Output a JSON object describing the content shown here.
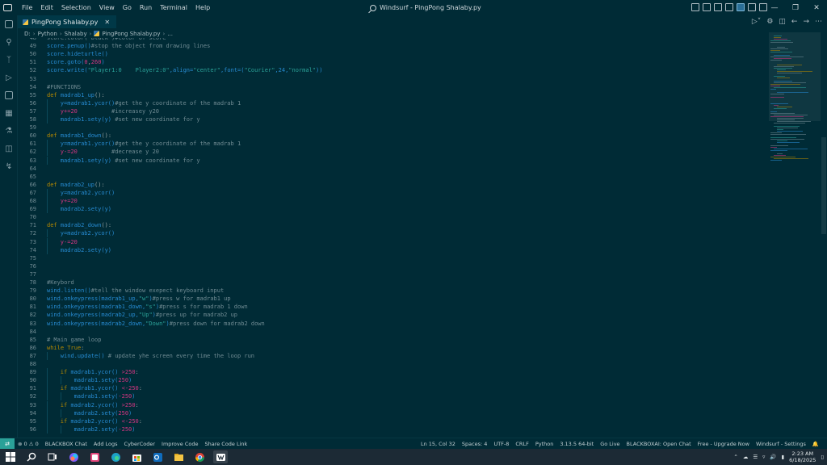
{
  "titlebar": {
    "menu": [
      "File",
      "Edit",
      "Selection",
      "View",
      "Go",
      "Run",
      "Terminal",
      "Help"
    ],
    "title": "Windsurf - PingPong Shalaby.py"
  },
  "tab": {
    "label": "PingPong Shalaby.py"
  },
  "breadcrumb": [
    "D:",
    "Python",
    "Shalaby",
    "PingPong Shalaby.py",
    "..."
  ],
  "editor": {
    "lines": [
      {
        "n": 48,
        "indent": 0,
        "tokens": [
          [
            "score.color(\"black\")#color of score",
            "#6f8b93"
          ]
        ]
      },
      {
        "n": 49,
        "indent": 0,
        "tokens": [
          [
            "score.penup()",
            "#268bd2"
          ],
          [
            "#stop the object from drawing lines",
            "#6f8b93"
          ]
        ]
      },
      {
        "n": 50,
        "indent": 0,
        "tokens": [
          [
            "score.hideturtle()",
            "#268bd2"
          ]
        ]
      },
      {
        "n": 51,
        "indent": 0,
        "tokens": [
          [
            "score.goto(",
            "#268bd2"
          ],
          [
            "0",
            "#d33682"
          ],
          [
            ",",
            "#93a1a1"
          ],
          [
            "260",
            "#d33682"
          ],
          [
            ")",
            "#268bd2"
          ]
        ]
      },
      {
        "n": 52,
        "indent": 0,
        "tokens": [
          [
            "score.write(",
            "#268bd2"
          ],
          [
            "\"Player1:0    Player2:0\"",
            "#2aa198"
          ],
          [
            ",align=",
            "#268bd2"
          ],
          [
            "\"center\"",
            "#2aa198"
          ],
          [
            ",font=(",
            "#268bd2"
          ],
          [
            "\"Courier\"",
            "#2aa198"
          ],
          [
            ",24,",
            "#268bd2"
          ],
          [
            "\"normal\"",
            "#2aa198"
          ],
          [
            "))",
            "#268bd2"
          ]
        ]
      },
      {
        "n": 53,
        "indent": 0,
        "tokens": []
      },
      {
        "n": 54,
        "indent": 0,
        "tokens": [
          [
            "#FUNCTIONS",
            "#6f8b93"
          ]
        ]
      },
      {
        "n": 55,
        "indent": 0,
        "tokens": [
          [
            "def ",
            "#b58900"
          ],
          [
            "madrab1_up",
            "#268bd2"
          ],
          [
            "():",
            "#93a1a1"
          ]
        ]
      },
      {
        "n": 56,
        "indent": 1,
        "tokens": [
          [
            "y=madrab1.ycor()",
            "#268bd2"
          ],
          [
            "#get the y coordinate of the madrab 1",
            "#6f8b93"
          ]
        ]
      },
      {
        "n": 57,
        "indent": 1,
        "tokens": [
          [
            "y+=20",
            "#d33682"
          ],
          [
            "          #increasey y20",
            "#6f8b93"
          ]
        ]
      },
      {
        "n": 58,
        "indent": 1,
        "tokens": [
          [
            "madrab1.sety(y)",
            "#268bd2"
          ],
          [
            " #set new coordinate for y",
            "#6f8b93"
          ]
        ]
      },
      {
        "n": 59,
        "indent": 0,
        "tokens": []
      },
      {
        "n": 60,
        "indent": 0,
        "tokens": [
          [
            "def ",
            "#b58900"
          ],
          [
            "madrab1_down",
            "#268bd2"
          ],
          [
            "():",
            "#93a1a1"
          ]
        ]
      },
      {
        "n": 61,
        "indent": 1,
        "tokens": [
          [
            "y=madrab1.ycor()",
            "#268bd2"
          ],
          [
            "#get the y coordinate of the madrab 1",
            "#6f8b93"
          ]
        ]
      },
      {
        "n": 62,
        "indent": 1,
        "tokens": [
          [
            "y-=20",
            "#d33682"
          ],
          [
            "          #decrease y 20",
            "#6f8b93"
          ]
        ]
      },
      {
        "n": 63,
        "indent": 1,
        "tokens": [
          [
            "madrab1.sety(y)",
            "#268bd2"
          ],
          [
            " #set new coordinate for y",
            "#6f8b93"
          ]
        ]
      },
      {
        "n": 64,
        "indent": 0,
        "tokens": []
      },
      {
        "n": 65,
        "indent": 0,
        "tokens": []
      },
      {
        "n": 66,
        "indent": 0,
        "tokens": [
          [
            "def ",
            "#b58900"
          ],
          [
            "madrab2_up",
            "#268bd2"
          ],
          [
            "():",
            "#93a1a1"
          ]
        ]
      },
      {
        "n": 67,
        "indent": 1,
        "tokens": [
          [
            "y=madrab2.ycor()",
            "#268bd2"
          ]
        ]
      },
      {
        "n": 68,
        "indent": 1,
        "tokens": [
          [
            "y+=20",
            "#d33682"
          ]
        ]
      },
      {
        "n": 69,
        "indent": 1,
        "tokens": [
          [
            "madrab2.sety(y)",
            "#268bd2"
          ]
        ]
      },
      {
        "n": 70,
        "indent": 0,
        "tokens": []
      },
      {
        "n": 71,
        "indent": 0,
        "tokens": [
          [
            "def ",
            "#b58900"
          ],
          [
            "madrab2_down",
            "#268bd2"
          ],
          [
            "():",
            "#93a1a1"
          ]
        ]
      },
      {
        "n": 72,
        "indent": 1,
        "tokens": [
          [
            "y=madrab2.ycor()",
            "#268bd2"
          ]
        ]
      },
      {
        "n": 73,
        "indent": 1,
        "tokens": [
          [
            "y-=20",
            "#d33682"
          ]
        ]
      },
      {
        "n": 74,
        "indent": 1,
        "tokens": [
          [
            "madrab2.sety(y)",
            "#268bd2"
          ]
        ]
      },
      {
        "n": 75,
        "indent": 0,
        "tokens": []
      },
      {
        "n": 76,
        "indent": 0,
        "tokens": []
      },
      {
        "n": 77,
        "indent": 0,
        "tokens": []
      },
      {
        "n": 78,
        "indent": 0,
        "tokens": [
          [
            "#Keybord",
            "#6f8b93"
          ]
        ]
      },
      {
        "n": 79,
        "indent": 0,
        "tokens": [
          [
            "wind.listen()",
            "#268bd2"
          ],
          [
            "#tell the window exepect keyboard input",
            "#6f8b93"
          ]
        ]
      },
      {
        "n": 80,
        "indent": 0,
        "tokens": [
          [
            "wind.onkeypress(madrab1_up,",
            "#268bd2"
          ],
          [
            "\"w\"",
            "#2aa198"
          ],
          [
            ")",
            "#268bd2"
          ],
          [
            "#press w for madrab1 up",
            "#6f8b93"
          ]
        ]
      },
      {
        "n": 81,
        "indent": 0,
        "tokens": [
          [
            "wind.onkeypress(madrab1_down,",
            "#268bd2"
          ],
          [
            "\"s\"",
            "#2aa198"
          ],
          [
            ")",
            "#268bd2"
          ],
          [
            "#press s for madrab 1 down",
            "#6f8b93"
          ]
        ]
      },
      {
        "n": 82,
        "indent": 0,
        "tokens": [
          [
            "wind.onkeypress(madrab2_up,",
            "#268bd2"
          ],
          [
            "\"Up\"",
            "#2aa198"
          ],
          [
            ")",
            "#268bd2"
          ],
          [
            "#press up for madrab2 up",
            "#6f8b93"
          ]
        ]
      },
      {
        "n": 83,
        "indent": 0,
        "tokens": [
          [
            "wind.onkeypress(madrab2_down,",
            "#268bd2"
          ],
          [
            "\"Down\"",
            "#2aa198"
          ],
          [
            ")",
            "#268bd2"
          ],
          [
            "#press down for madrab2 down",
            "#6f8b93"
          ]
        ]
      },
      {
        "n": 84,
        "indent": 0,
        "tokens": []
      },
      {
        "n": 85,
        "indent": 0,
        "tokens": [
          [
            "# Main game loop",
            "#6f8b93"
          ]
        ]
      },
      {
        "n": 86,
        "indent": 0,
        "tokens": [
          [
            "while ",
            "#b58900"
          ],
          [
            "True",
            "#b58900"
          ],
          [
            ":",
            "#93a1a1"
          ]
        ]
      },
      {
        "n": 87,
        "indent": 1,
        "tokens": [
          [
            "wind.update()",
            "#268bd2"
          ],
          [
            " # update yhe screen every time the loop run",
            "#6f8b93"
          ]
        ]
      },
      {
        "n": 88,
        "indent": 0,
        "tokens": []
      },
      {
        "n": 89,
        "indent": 1,
        "tokens": [
          [
            "if ",
            "#b58900"
          ],
          [
            "madrab1.ycor() ",
            "#268bd2"
          ],
          [
            ">250",
            "#d33682"
          ],
          [
            ":",
            "#93a1a1"
          ]
        ]
      },
      {
        "n": 90,
        "indent": 2,
        "tokens": [
          [
            "madrab1.sety(",
            "#268bd2"
          ],
          [
            "250",
            "#d33682"
          ],
          [
            ")",
            "#268bd2"
          ]
        ]
      },
      {
        "n": 91,
        "indent": 1,
        "tokens": [
          [
            "if ",
            "#b58900"
          ],
          [
            "madrab1.ycor() ",
            "#268bd2"
          ],
          [
            "<-250",
            "#d33682"
          ],
          [
            ":",
            "#93a1a1"
          ]
        ]
      },
      {
        "n": 92,
        "indent": 2,
        "tokens": [
          [
            "madrab1.sety(",
            "#268bd2"
          ],
          [
            "-250",
            "#d33682"
          ],
          [
            ")",
            "#268bd2"
          ]
        ]
      },
      {
        "n": 93,
        "indent": 1,
        "tokens": [
          [
            "if ",
            "#b58900"
          ],
          [
            "madrab2.ycor() ",
            "#268bd2"
          ],
          [
            ">250",
            "#d33682"
          ],
          [
            ":",
            "#93a1a1"
          ]
        ]
      },
      {
        "n": 94,
        "indent": 2,
        "tokens": [
          [
            "madrab2.sety(",
            "#268bd2"
          ],
          [
            "250",
            "#d33682"
          ],
          [
            ")",
            "#268bd2"
          ]
        ]
      },
      {
        "n": 95,
        "indent": 1,
        "tokens": [
          [
            "if ",
            "#b58900"
          ],
          [
            "madrab2.ycor() ",
            "#268bd2"
          ],
          [
            "<-250",
            "#d33682"
          ],
          [
            ":",
            "#93a1a1"
          ]
        ]
      },
      {
        "n": 96,
        "indent": 2,
        "tokens": [
          [
            "madrab2.sety(",
            "#268bd2"
          ],
          [
            "-250",
            "#d33682"
          ],
          [
            ")",
            "#268bd2"
          ]
        ]
      }
    ]
  },
  "statusbar": {
    "problems": "⊗ 0 ⚠ 0",
    "left": [
      "BLACKBOX Chat",
      "Add Logs",
      "CyberCoder",
      "Improve Code",
      "Share Code Link"
    ],
    "right": [
      "Ln 15, Col 32",
      "Spaces: 4",
      "UTF-8",
      "CRLF",
      "Python",
      "3.13.5 64-bit",
      "Go Live",
      "BLACKBOXAI: Open Chat",
      "Free - Upgrade Now",
      "Windsurf - Settings"
    ]
  },
  "taskbar": {
    "time": "2:23 AM",
    "date": "6/18/2025"
  },
  "icons": {
    "activity": [
      "explorer-icon",
      "search-icon",
      "source-control-icon",
      "run-debug-icon",
      "remote-icon",
      "extensions-icon",
      "testing-icon",
      "chat-icon",
      "windsurf-icon"
    ]
  }
}
